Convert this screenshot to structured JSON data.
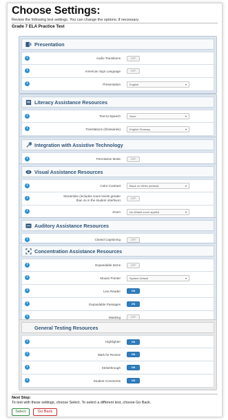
{
  "header": {
    "title": "Choose Settings:",
    "subtitle": "Review the following test settings. You can change the options, if necessary.",
    "test_name": "Grade 7 ELA Practice Test"
  },
  "colors": {
    "accent": "#2e7dbf",
    "section_bg": "#dde6f0",
    "select_border": "#2f8a3a",
    "back_border": "#c3282b"
  },
  "sections": [
    {
      "title": "Presentation",
      "icon": "presentation-icon",
      "rows": [
        {
          "label": "Audio Transitions",
          "control": "toggle",
          "value": "OFF"
        },
        {
          "label": "American Sign Language",
          "control": "toggle",
          "value": "OFF"
        },
        {
          "label": "Presentation",
          "control": "select",
          "value": "English"
        }
      ]
    },
    {
      "title": "Literacy Assistance Resources",
      "icon": "book-icon",
      "rows": [
        {
          "label": "Text-to-Speech",
          "control": "select",
          "value": "None"
        },
        {
          "label": "Translations (Glossaries)",
          "control": "select",
          "value": "English Glossary"
        }
      ]
    },
    {
      "title": "Integration with Assistive Technology",
      "icon": "wrench-icon",
      "rows": [
        {
          "label": "Permissive Mode",
          "control": "toggle",
          "value": "OFF"
        }
      ]
    },
    {
      "title": "Visual Assistance Resources",
      "icon": "eye-icon",
      "rows": [
        {
          "label": "Color Contrast",
          "control": "select",
          "value": "Black on White (default)"
        },
        {
          "label": "Streamline (includes zoom levels greater than 4x in the student interface)",
          "control": "toggle",
          "value": "OFF"
        },
        {
          "label": "Zoom",
          "control": "select",
          "value": "No default zoom applied"
        }
      ]
    },
    {
      "title": "Auditory Assistance Resources",
      "icon": "caption-icon",
      "rows": [
        {
          "label": "Closed Captioning",
          "control": "toggle",
          "value": "OFF"
        }
      ]
    },
    {
      "title": "Concentration Assistance Resources",
      "icon": "focus-icon",
      "rows": [
        {
          "label": "Expandable Items",
          "control": "toggle",
          "value": "OFF"
        },
        {
          "label": "Mouse Pointer",
          "control": "select",
          "value": "System Default"
        },
        {
          "label": "Line Reader",
          "control": "toggle",
          "value": "ON"
        },
        {
          "label": "Expandable Passages",
          "control": "toggle",
          "value": "ON"
        },
        {
          "label": "Masking",
          "control": "toggle",
          "value": "OFF"
        }
      ]
    },
    {
      "title": "General Testing Resources",
      "icon": "blank-icon",
      "rows": [
        {
          "label": "Highlighter",
          "control": "toggle",
          "value": "ON"
        },
        {
          "label": "Mark for Review",
          "control": "toggle",
          "value": "ON"
        },
        {
          "label": "Strikethrough",
          "control": "toggle",
          "value": "ON"
        },
        {
          "label": "Student Comments",
          "control": "toggle",
          "value": "ON"
        }
      ]
    }
  ],
  "footer": {
    "next_step_title": "Next Step:",
    "next_step_text": "To test with these settings, choose Select. To select a different test, choose Go Back.",
    "select_label": "Select",
    "back_label": "Go Back"
  }
}
